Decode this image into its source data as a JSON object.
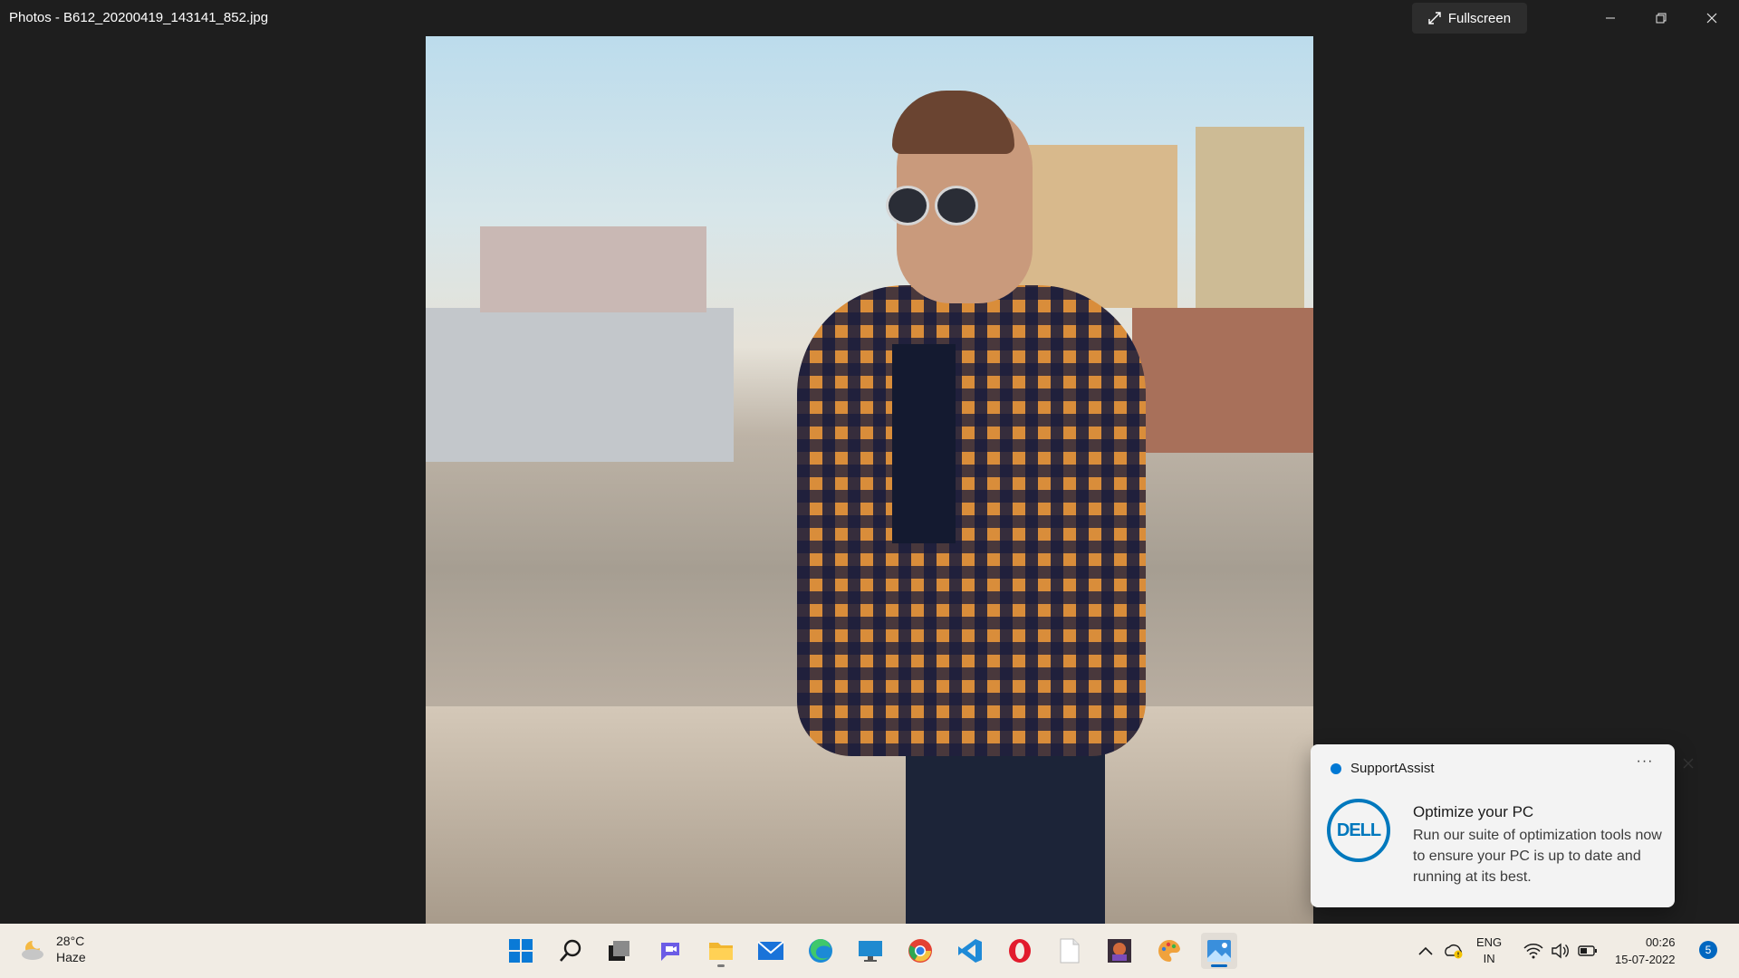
{
  "window": {
    "title": "Photos - B612_20200419_143141_852.jpg",
    "fullscreen_label": "Fullscreen",
    "controls": [
      "minimize-icon",
      "restore-icon",
      "close-icon"
    ]
  },
  "photo": {
    "description_icon": "photo-image"
  },
  "notification": {
    "app_name": "SupportAssist",
    "logo_text": "DELL",
    "title": "Optimize your PC",
    "body": "Run our suite of optimization tools now to ensure your PC is up to date and running at its best.",
    "more_label": "···"
  },
  "taskbar": {
    "weather": {
      "temp": "28°C",
      "condition": "Haze",
      "icon": "partly-cloudy-icon"
    },
    "apps": [
      {
        "name": "start",
        "icon": "windows-start-icon"
      },
      {
        "name": "search",
        "icon": "search-icon"
      },
      {
        "name": "task-view",
        "icon": "task-view-icon"
      },
      {
        "name": "teams-chat",
        "icon": "chat-icon"
      },
      {
        "name": "file-explorer",
        "icon": "folder-icon"
      },
      {
        "name": "mail",
        "icon": "mail-icon"
      },
      {
        "name": "edge",
        "icon": "edge-icon"
      },
      {
        "name": "remote-desktop",
        "icon": "monitor-icon"
      },
      {
        "name": "chrome",
        "icon": "chrome-icon"
      },
      {
        "name": "vscode",
        "icon": "vscode-icon"
      },
      {
        "name": "opera",
        "icon": "opera-icon"
      },
      {
        "name": "notepad",
        "icon": "document-icon"
      },
      {
        "name": "game",
        "icon": "game-icon"
      },
      {
        "name": "paint",
        "icon": "palette-icon"
      },
      {
        "name": "photos",
        "icon": "photos-icon"
      }
    ],
    "tray": {
      "lang_line1": "ENG",
      "lang_line2": "IN",
      "time": "00:26",
      "date": "15-07-2022",
      "notification_count": "5"
    }
  },
  "colors": {
    "accent": "#0067c0",
    "dell_blue": "#0078bd",
    "background": "#1e1e1e",
    "taskbar": "#f1ece4"
  }
}
